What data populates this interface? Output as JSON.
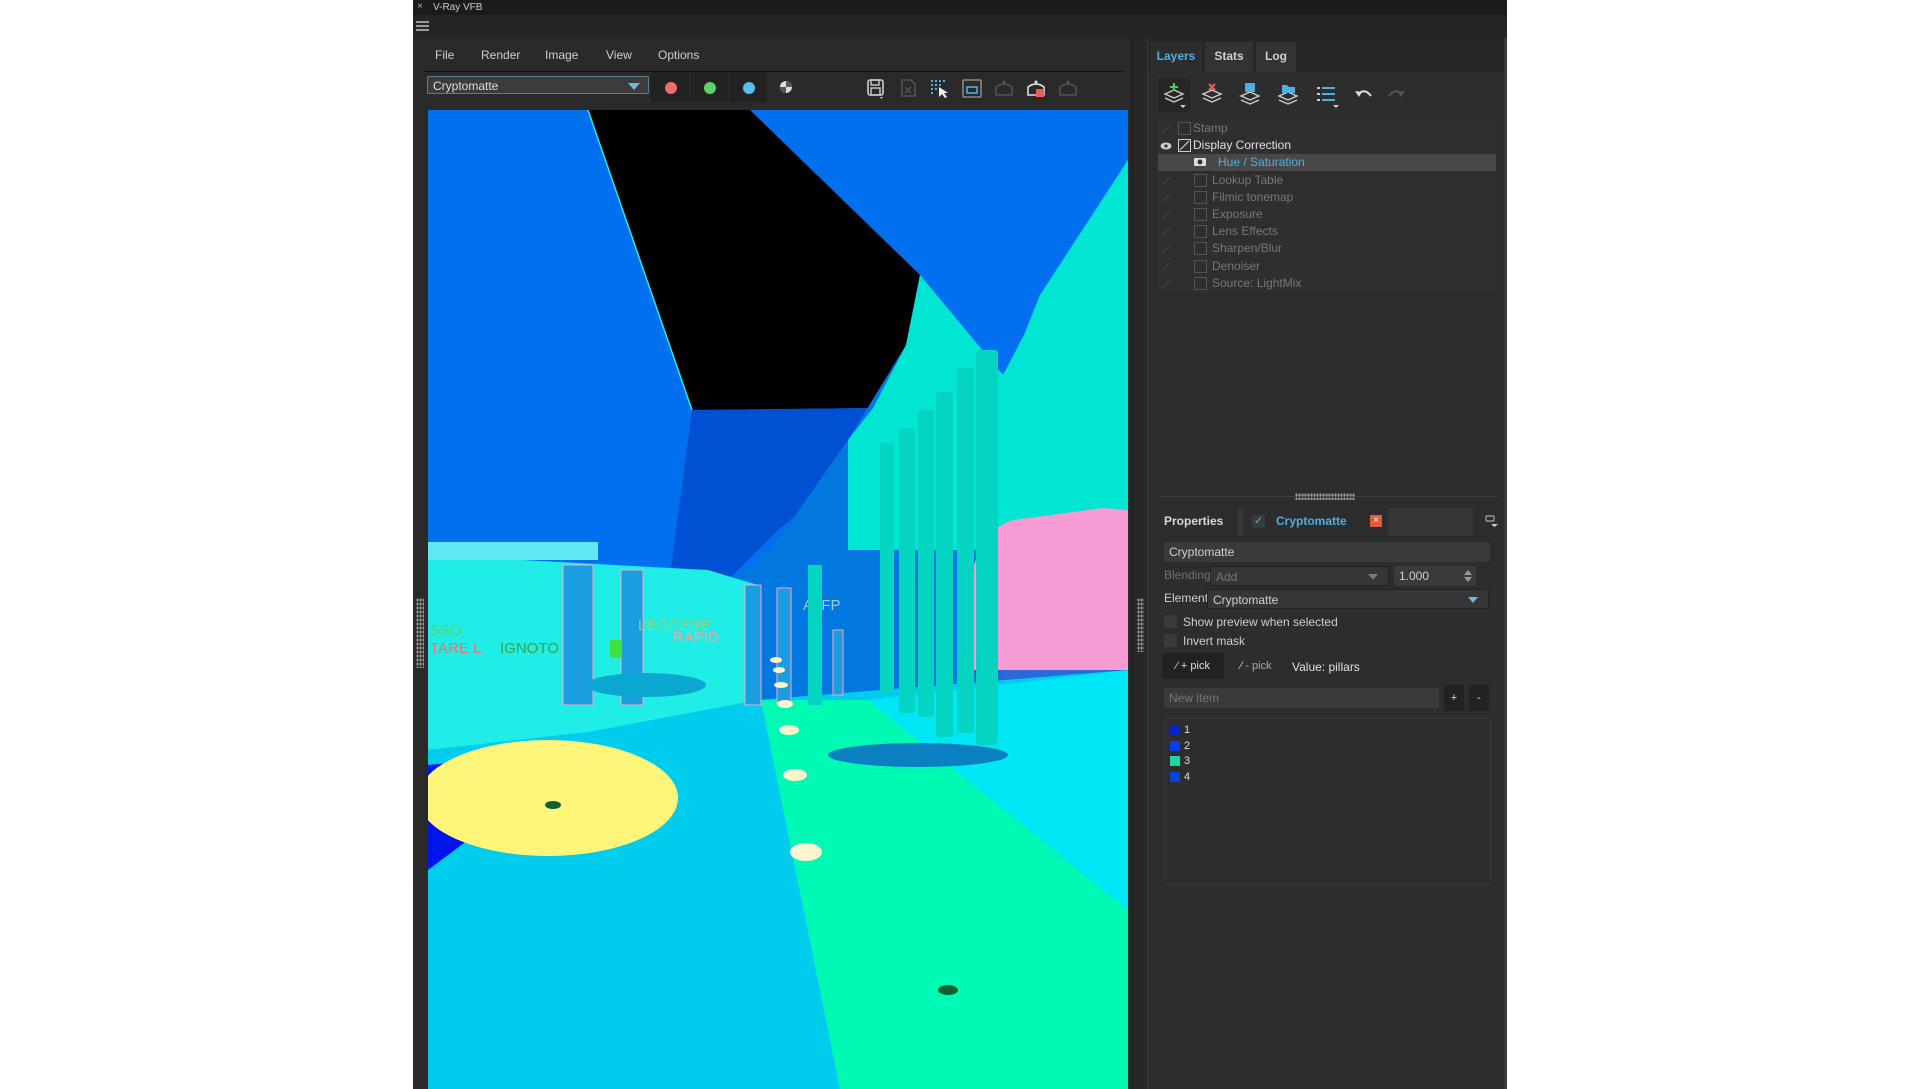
{
  "window": {
    "title": "V-Ray VFB",
    "close_glyph": "×"
  },
  "menubar": {
    "items": [
      {
        "label": "File"
      },
      {
        "label": "Render"
      },
      {
        "label": "Image"
      },
      {
        "label": "View"
      },
      {
        "label": "Options"
      }
    ]
  },
  "toolbar": {
    "channel_select": {
      "value": "Cryptomatte"
    },
    "channel_dots": [
      {
        "name": "red-channel",
        "color": "#f06b6b"
      },
      {
        "name": "green-channel",
        "color": "#5cd26a"
      },
      {
        "name": "blue-channel",
        "color": "#5bbcf2"
      }
    ],
    "icons": [
      "alpha-channel-icon",
      "save-image-icon",
      "clear-image-icon",
      "region-render-icon",
      "compare-icon",
      "render-interactive-icon",
      "stop-render-icon",
      "render-icon"
    ]
  },
  "right_panel": {
    "tabs": [
      {
        "label": "Layers",
        "active": true
      },
      {
        "label": "Stats",
        "active": false
      },
      {
        "label": "Log",
        "active": false
      }
    ],
    "layer_tools": [
      "add-layer-icon",
      "delete-layer-icon",
      "save-layers-icon",
      "load-layers-icon",
      "layer-presets-icon",
      "undo-icon",
      "redo-icon"
    ],
    "layers": [
      {
        "label": "Stamp",
        "visible": false,
        "indent": 0,
        "selected": false,
        "enabled": false
      },
      {
        "label": "Display Correction",
        "visible": true,
        "indent": 0,
        "selected": false,
        "enabled": true
      },
      {
        "label": "Hue / Saturation",
        "visible": false,
        "indent": 1,
        "selected": true,
        "enabled": true
      },
      {
        "label": "Lookup Table",
        "visible": false,
        "indent": 1,
        "selected": false,
        "enabled": false
      },
      {
        "label": "Filmic tonemap",
        "visible": false,
        "indent": 1,
        "selected": false,
        "enabled": false
      },
      {
        "label": "Exposure",
        "visible": false,
        "indent": 1,
        "selected": false,
        "enabled": false
      },
      {
        "label": "Lens Effects",
        "visible": false,
        "indent": 1,
        "selected": false,
        "enabled": false
      },
      {
        "label": "Sharpen/Blur",
        "visible": false,
        "indent": 1,
        "selected": false,
        "enabled": false
      },
      {
        "label": "Denoiser",
        "visible": false,
        "indent": 1,
        "selected": false,
        "enabled": false
      },
      {
        "label": "Source: LightMix",
        "visible": false,
        "indent": 1,
        "selected": false,
        "enabled": false
      }
    ],
    "properties": {
      "title": "Properties",
      "layer_enabled": true,
      "layer_name": "Cryptomatte",
      "delete_glyph": "×",
      "name_field": "Cryptomatte",
      "blending_label": "Blending",
      "blending_value": "Add",
      "opacity_value": "1.000",
      "element_label": "Element",
      "element_value": "Cryptomatte",
      "show_preview_label": "Show preview when selected",
      "show_preview_checked": false,
      "invert_mask_label": "Invert mask",
      "invert_mask_checked": false,
      "pick_add_label": "+ pick",
      "pick_remove_label": "- pick",
      "value_text": "Value: pillars",
      "new_item_placeholder": "New item",
      "add_item_label": "+",
      "remove_item_label": "-",
      "items": [
        {
          "label": "1",
          "color": "#0a22c8"
        },
        {
          "label": "2",
          "color": "#0a3cf0"
        },
        {
          "label": "3",
          "color": "#19d6a8"
        },
        {
          "label": "4",
          "color": "#0a40dc"
        }
      ]
    }
  },
  "render_colors": {
    "sky_blue": "#0070ee",
    "black_void": "#000000",
    "roof_dark": "#0050d4",
    "roof_mid": "#0078e0",
    "building_teal": "#00e6d2",
    "pillar": "#06d4c2",
    "pink": "#f79bd4",
    "floor_cyan": "#00cdee",
    "path_green": "#00fab4",
    "floor_right": "#00e6f4",
    "dark_floor": "#0014ec",
    "yellow_patch": "#fff57a",
    "wall_cyan": "#20eee6"
  }
}
